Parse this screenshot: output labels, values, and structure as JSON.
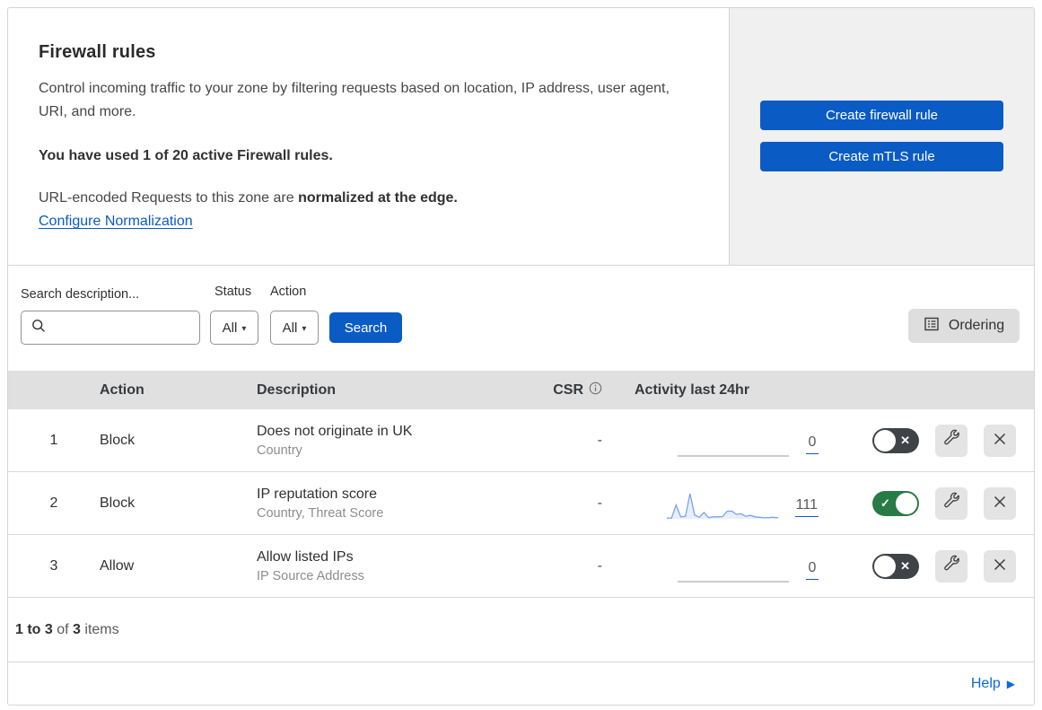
{
  "colors": {
    "accent_blue": "#0b5bc5",
    "toggle_green": "#287a46",
    "toggle_off_gray": "#3f4347",
    "sparkline_blue": "#7aa5e9",
    "header_gray": "#e0e0e0"
  },
  "header": {
    "title": "Firewall rules",
    "description": "Control incoming traffic to your zone by filtering requests based on location, IP address, user agent, URI, and more.",
    "usage": "You have used 1 of 20 active Firewall rules.",
    "normalization_text": "URL-encoded Requests to this zone are ",
    "normalization_bold": "normalized at the edge.",
    "normalization_link": "Configure Normalization",
    "create_firewall_button": "Create firewall rule",
    "create_mtls_button": "Create mTLS rule"
  },
  "filters": {
    "search_label": "Search description...",
    "search_value": "",
    "status_label": "Status",
    "status_value": "All",
    "action_label": "Action",
    "action_value": "All",
    "search_button": "Search",
    "ordering_button": "Ordering"
  },
  "table": {
    "columns": {
      "action": "Action",
      "description": "Description",
      "csr": "CSR",
      "activity": "Activity last 24hr"
    },
    "rows": [
      {
        "num": "1",
        "action": "Block",
        "description": "Does not originate in UK",
        "fields": "Country",
        "csr": "-",
        "activity_count": "0",
        "enabled": false,
        "sparkline": [
          0,
          0
        ]
      },
      {
        "num": "2",
        "action": "Block",
        "description": "IP reputation score",
        "fields": "Country, Threat Score",
        "csr": "-",
        "activity_count": "111",
        "enabled": true,
        "sparkline": [
          2,
          3,
          55,
          8,
          10,
          100,
          15,
          6,
          25,
          5,
          8,
          8,
          9,
          30,
          31,
          18,
          20,
          10,
          14,
          8,
          6,
          4,
          5,
          6,
          4
        ]
      },
      {
        "num": "3",
        "action": "Allow",
        "description": "Allow listed IPs",
        "fields": "IP Source Address",
        "csr": "-",
        "activity_count": "0",
        "enabled": false,
        "sparkline": [
          0,
          0
        ]
      }
    ]
  },
  "footer": {
    "range": "1 to 3",
    "of": "of",
    "total": "3",
    "items": "items",
    "help": "Help"
  }
}
